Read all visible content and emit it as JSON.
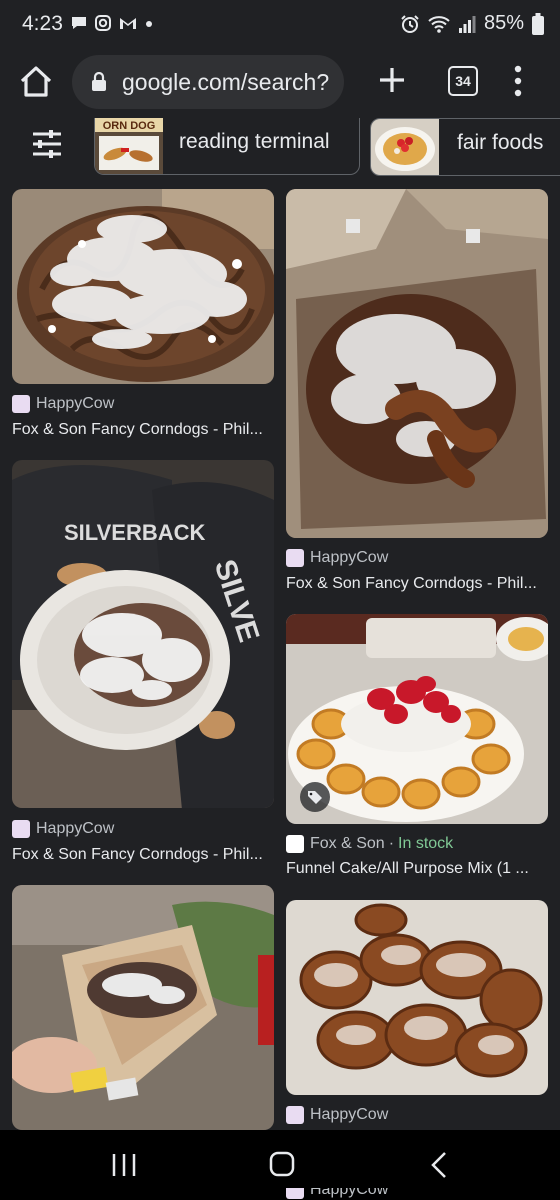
{
  "status": {
    "time": "4:23",
    "battery": "85%"
  },
  "browser": {
    "url": "google.com/search?",
    "tab_count": "34"
  },
  "chips": [
    {
      "label": "reading terminal",
      "thumb_text": "ORN DOG"
    },
    {
      "label": "fair foods"
    }
  ],
  "results": [
    {
      "source": "HappyCow",
      "title": "Fox & Son Fancy Corndogs - Phil..."
    },
    {
      "source": "HappyCow",
      "title": "Fox & Son Fancy Corndogs - Phil..."
    },
    {
      "source": "HappyCow",
      "title": "Fox & Son Fancy Corndogs - Phil...",
      "shirt_text": "SILVERBACK",
      "shirt_text2": "SILVE"
    },
    {
      "source": "Fox & Son",
      "stock": "In stock",
      "title": "Funnel Cake/All Purpose Mix (1 ..."
    },
    {
      "source": "HappyCow"
    },
    {
      "source": "HappyCow",
      "cut_label": "HappyCow"
    }
  ],
  "colors": {
    "background": "#202124",
    "url_bar": "#303134",
    "in_stock": "#81c995"
  }
}
